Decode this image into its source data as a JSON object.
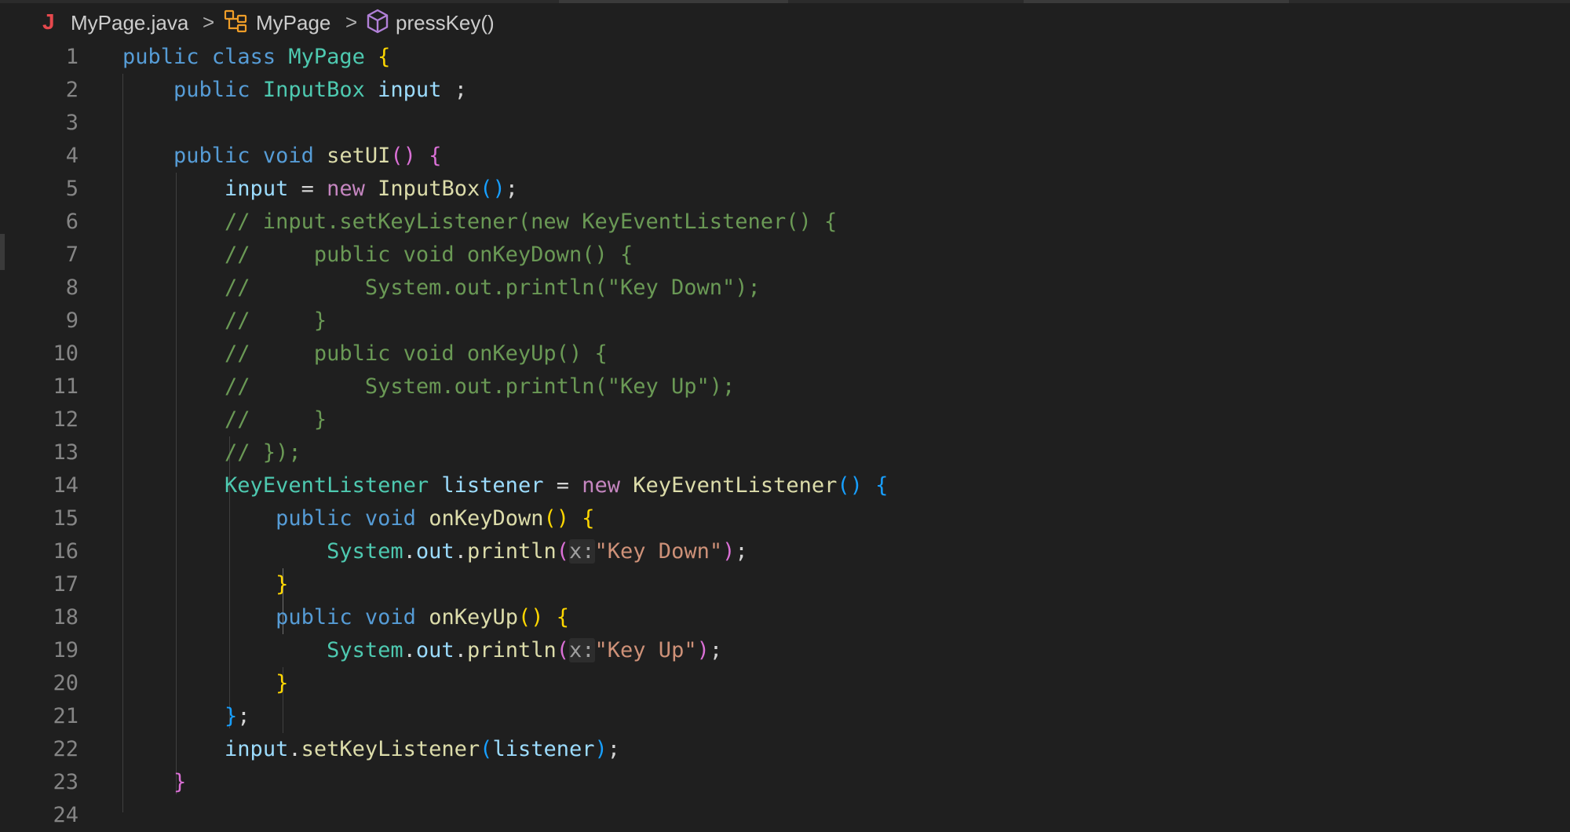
{
  "breadcrumb": {
    "file_icon": "J",
    "file": "MyPage.java",
    "class_name": "MyPage",
    "method": "pressKey()",
    "separator": ">"
  },
  "icons": {
    "file_icon": "java-icon",
    "class_icon": "class-symbol-icon",
    "method_icon": "method-cube-icon",
    "separator_icon": "chevron-right-icon"
  },
  "colors": {
    "background": "#1f1f1f",
    "keyword": "#569cd6",
    "control_keyword": "#c586c0",
    "type": "#4ec9b0",
    "function": "#dcdcaa",
    "variable": "#9cdcfe",
    "string": "#ce9178",
    "comment": "#6a9955",
    "bracket_level1": "#ffd700",
    "bracket_level2": "#da70d6",
    "bracket_level3": "#179fff",
    "line_number": "#858585"
  },
  "editor": {
    "lines": [
      {
        "n": "1",
        "text": "public class MyPage {"
      },
      {
        "n": "2",
        "text": "    public InputBox input ;"
      },
      {
        "n": "3",
        "text": ""
      },
      {
        "n": "4",
        "text": "    public void setUI() {"
      },
      {
        "n": "5",
        "text": "        input = new InputBox();"
      },
      {
        "n": "6",
        "text": "        // input.setKeyListener(new KeyEventListener() {"
      },
      {
        "n": "7",
        "text": "        //     public void onKeyDown() {"
      },
      {
        "n": "8",
        "text": "        //         System.out.println(\"Key Down\");"
      },
      {
        "n": "9",
        "text": "        //     }"
      },
      {
        "n": "10",
        "text": "        //     public void onKeyUp() {"
      },
      {
        "n": "11",
        "text": "        //         System.out.println(\"Key Up\");"
      },
      {
        "n": "12",
        "text": "        //     }"
      },
      {
        "n": "13",
        "text": "        // });"
      },
      {
        "n": "14",
        "text": "        KeyEventListener listener = new KeyEventListener() {"
      },
      {
        "n": "15",
        "text": "            public void onKeyDown() {"
      },
      {
        "n": "16",
        "text": "                System.out.println(x:\"Key Down\");"
      },
      {
        "n": "17",
        "text": "            }"
      },
      {
        "n": "18",
        "text": "            public void onKeyUp() {"
      },
      {
        "n": "19",
        "text": "                System.out.println(x:\"Key Up\");"
      },
      {
        "n": "20",
        "text": "            }"
      },
      {
        "n": "21",
        "text": "        };"
      },
      {
        "n": "22",
        "text": "        input.setKeyListener(listener);"
      },
      {
        "n": "23",
        "text": "    }"
      },
      {
        "n": "24",
        "text": ""
      }
    ]
  }
}
